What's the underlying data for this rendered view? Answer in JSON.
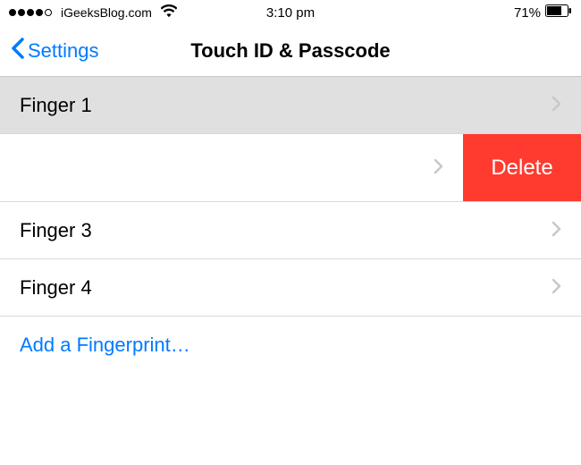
{
  "status_bar": {
    "carrier": "iGeeksBlog.com",
    "time": "3:10 pm",
    "battery_pct": "71%"
  },
  "nav": {
    "back_label": "Settings",
    "title": "Touch ID & Passcode"
  },
  "rows": {
    "finger1": "Finger 1",
    "finger3": "Finger 3",
    "finger4": "Finger 4"
  },
  "delete_label": "Delete",
  "add_label": "Add a Fingerprint…"
}
